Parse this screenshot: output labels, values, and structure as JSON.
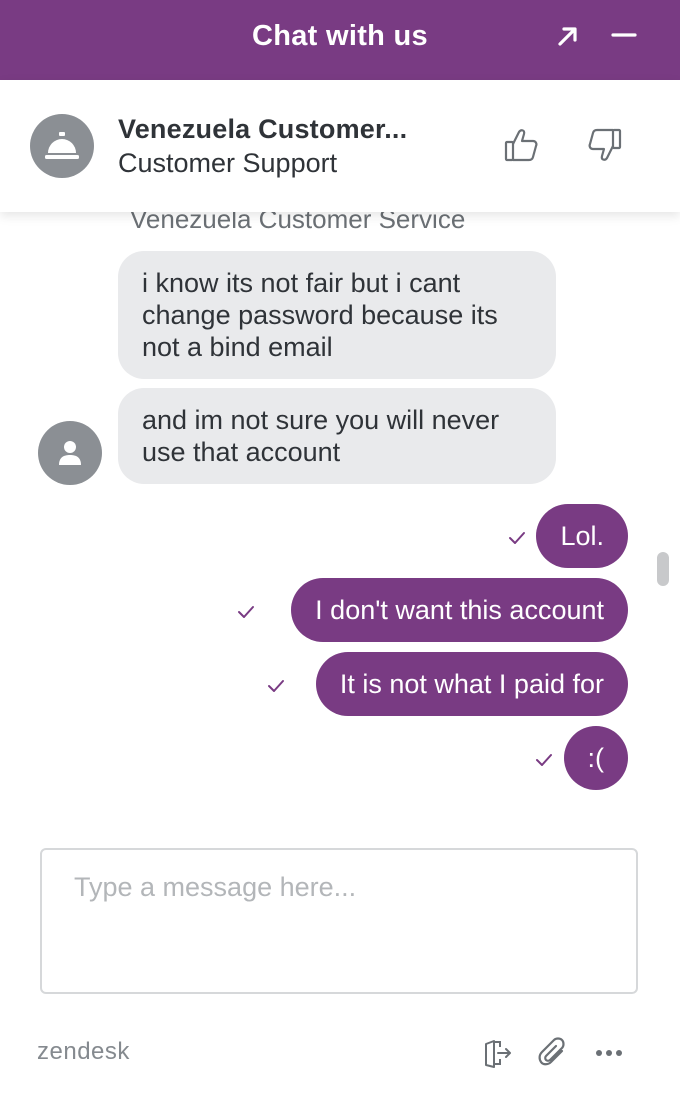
{
  "window": {
    "title": "Chat with us",
    "popout_icon": "arrow-up-right-icon",
    "minimize_icon": "minus-icon",
    "accent": "#793b83"
  },
  "agent": {
    "name": "Venezuela Customer...",
    "role": "Customer Support",
    "avatar_icon": "service-bell-icon",
    "rate_good_icon": "thumbs-up-icon",
    "rate_bad_icon": "thumbs-down-icon"
  },
  "conversation": {
    "sender_label": "Venezuela Customer Service",
    "incoming": [
      {
        "text": "i know its not fair but i cant change password because its not a bind email"
      },
      {
        "text": "and im not sure you will never use that account"
      }
    ],
    "outgoing": [
      {
        "text": "Lol.",
        "status_icon": "checkmark-icon"
      },
      {
        "text": "I don't want this account",
        "status_icon": "checkmark-icon"
      },
      {
        "text": "It is not what I paid for",
        "status_icon": "checkmark-icon"
      },
      {
        "text": ":(",
        "status_icon": "checkmark-icon"
      }
    ],
    "bubble_in_color": "#e9eaec",
    "bubble_out_color": "#793b83"
  },
  "composer": {
    "placeholder": "Type a message here...",
    "value": ""
  },
  "footer": {
    "brand": "zendesk",
    "end_chat_icon": "exit-door-icon",
    "attach_icon": "paperclip-icon",
    "more_icon": "ellipsis-icon"
  }
}
